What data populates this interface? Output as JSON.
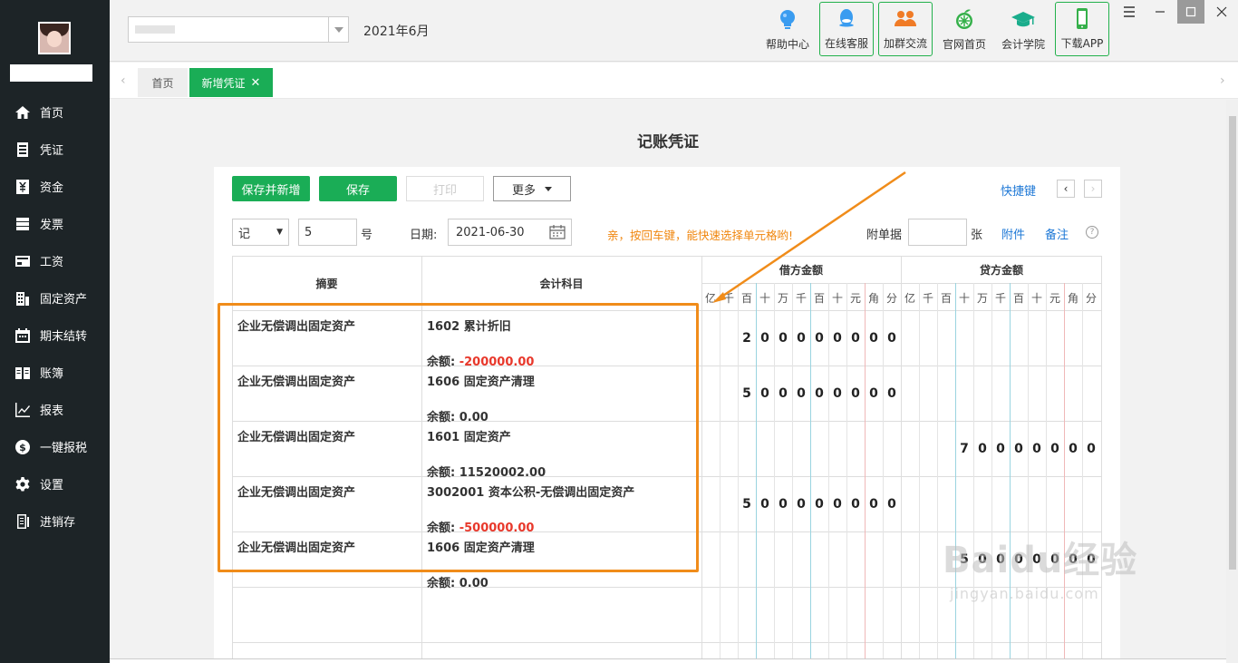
{
  "sidebar": {
    "items": [
      {
        "label": "首页",
        "icon": "home-icon"
      },
      {
        "label": "凭证",
        "icon": "voucher-icon"
      },
      {
        "label": "资金",
        "icon": "yen-icon"
      },
      {
        "label": "发票",
        "icon": "invoice-icon"
      },
      {
        "label": "工资",
        "icon": "card-icon"
      },
      {
        "label": "固定资产",
        "icon": "building-icon"
      },
      {
        "label": "期末结转",
        "icon": "calendar-icon"
      },
      {
        "label": "账簿",
        "icon": "book-icon"
      },
      {
        "label": "报表",
        "icon": "chart-icon"
      },
      {
        "label": "一键报税",
        "icon": "dollar-icon"
      },
      {
        "label": "设置",
        "icon": "gear-icon"
      },
      {
        "label": "进销存",
        "icon": "stock-icon"
      }
    ]
  },
  "header": {
    "period": "2021年6月",
    "tools": [
      {
        "label": "帮助中心",
        "icon": "bulb-icon"
      },
      {
        "label": "在线客服",
        "icon": "qq-icon"
      },
      {
        "label": "加群交流",
        "icon": "group-icon"
      },
      {
        "label": "官网首页",
        "icon": "lemon-icon"
      },
      {
        "label": "会计学院",
        "icon": "graduation-cap-icon"
      },
      {
        "label": "下载APP",
        "icon": "phone-icon"
      }
    ]
  },
  "tabs": {
    "home": "首页",
    "current": "新增凭证",
    "close": "✕"
  },
  "voucher": {
    "title": "记账凭证",
    "buttons": {
      "save_new": "保存并新增",
      "save": "保存",
      "print": "打印",
      "more": "更多",
      "shortcut": "快捷键"
    },
    "word": "记",
    "number": "5",
    "number_suffix": "号",
    "date_label": "日期:",
    "date": "2021-06-30",
    "hint": "亲，按回车键，能快速选择单元格哟!",
    "attach_label": "附单据",
    "attach_value": "",
    "attach_unit": "张",
    "attachment_link": "附件",
    "note_link": "备注",
    "help": "?"
  },
  "table": {
    "headers": {
      "summary": "摘要",
      "account": "会计科目",
      "debit": "借方金额",
      "credit": "贷方金额"
    },
    "units": [
      "亿",
      "千",
      "百",
      "十",
      "万",
      "千",
      "百",
      "十",
      "元",
      "角",
      "分"
    ],
    "balance_label": "余额:",
    "rows": [
      {
        "summary": "企业无偿调出固定资产",
        "account": "1602 累计折旧",
        "balance": "-200000.00",
        "balance_negative": true,
        "debit": "200000000",
        "credit": ""
      },
      {
        "summary": "企业无偿调出固定资产",
        "account": "1606 固定资产清理",
        "balance": "0.00",
        "balance_negative": false,
        "debit": "500000000",
        "credit": ""
      },
      {
        "summary": "企业无偿调出固定资产",
        "account": "1601 固定资产",
        "balance": "11520002.00",
        "balance_negative": false,
        "debit": "",
        "credit": "70000000"
      },
      {
        "summary": "企业无偿调出固定资产",
        "account": "3002001 资本公积-无偿调出固定资产",
        "balance": "-500000.00",
        "balance_negative": true,
        "debit": "500000000",
        "credit": ""
      },
      {
        "summary": "企业无偿调出固定资产",
        "account": "1606 固定资产清理",
        "balance": "0.00",
        "balance_negative": false,
        "debit": "",
        "credit": "50000000"
      }
    ]
  },
  "watermark": {
    "main": "Baidu经验",
    "sub": "jingyan.baidu.com"
  },
  "colors": {
    "sidebar_bg": "#1d2427",
    "accent_green": "#1aad56",
    "negative_red": "#e8382b",
    "hint_orange": "#f0870f",
    "annotation_orange": "#f08c1a",
    "link_blue": "#1e78d6"
  }
}
